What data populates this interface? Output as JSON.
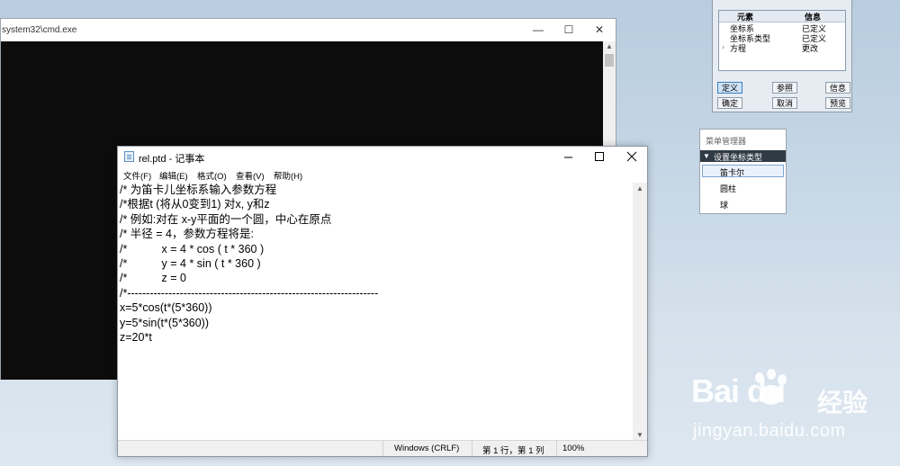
{
  "cmd": {
    "title": "system32\\cmd.exe",
    "minimize": "—",
    "maximize": "☐",
    "close": "✕"
  },
  "notepad": {
    "title": "rel.ptd - 记事本",
    "menu": [
      "文件(F)",
      "编辑(E)",
      "格式(O)",
      "查看(V)",
      "帮助(H)"
    ],
    "text": "/* 为笛卡儿坐标系输入参数方程\n/*根据t (将从0变到1) 对x, y和z\n/* 例如:对在 x-y平面的一个圆，中心在原点\n/* 半径 = 4，参数方程将是:\n/*           x = 4 * cos ( t * 360 )\n/*           y = 4 * sin ( t * 360 )\n/*           z = 0\n/*-------------------------------------------------------------------\nx=5*cos(t*(5*360))\ny=5*sin(t*(5*360))\nz=20*t",
    "status": {
      "encoding": "Windows (CRLF)",
      "position": "第 1 行，第 1 列",
      "zoom": "100%"
    }
  },
  "element_dialog": {
    "headers": [
      "元素",
      "信息"
    ],
    "rows": [
      {
        "element": "坐标系",
        "info": "已定义"
      },
      {
        "element": "坐标系类型",
        "info": "已定义"
      },
      {
        "element": "方程",
        "info": "更改"
      }
    ],
    "buttons": [
      "定义",
      "参照",
      "信息",
      "确定",
      "取消",
      "预览"
    ]
  },
  "menu_manager": {
    "title": "菜单管理器",
    "section": "设置坐标类型",
    "items": [
      "笛卡尔",
      "圆柱",
      "球"
    ]
  },
  "watermark": {
    "logo": "Bai du",
    "cn": "经验",
    "url": "jingyan.baidu.com"
  }
}
